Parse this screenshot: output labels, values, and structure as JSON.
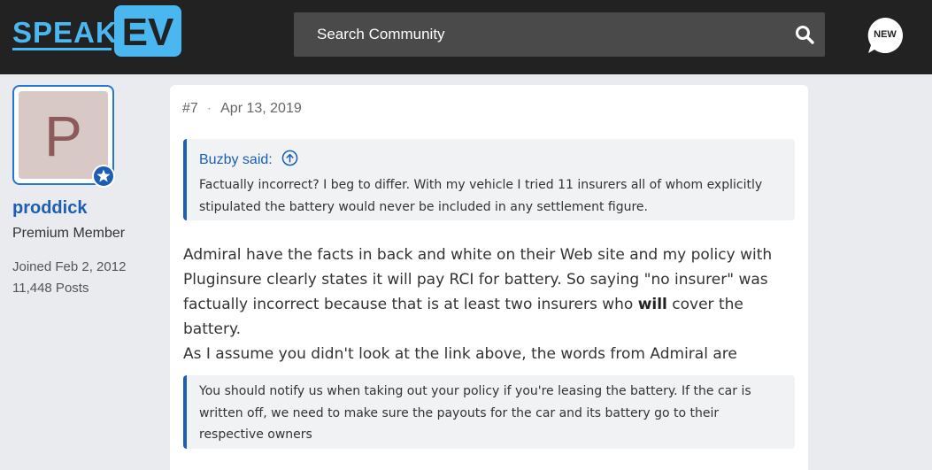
{
  "header": {
    "logo_text_speak": "SPEAK",
    "logo_text_ev": "EV",
    "search_placeholder": "Search Community",
    "new_badge": "NEW",
    "colors": {
      "background": "#222222",
      "accent": "#4ab7f0",
      "search_bg": "#4a4a4a"
    }
  },
  "user": {
    "avatar_letter": "P",
    "username": "proddick",
    "title": "Premium Member",
    "joined": "Joined Feb 2, 2012",
    "posts": "11,448 Posts"
  },
  "post": {
    "number": "#7",
    "separator": "·",
    "date": "Apr 13, 2019",
    "quote": {
      "author_line": "Buzby said:",
      "text": "Factually incorrect? I beg to differ. With my vehicle I tried 11 insurers all of whom explicitly stipulated the battery would never be included in any settlement figure."
    },
    "paragraph1_before": "Admiral have the facts in back and white on their Web site and my policy with Pluginsure clearly states it will pay RCI for battery. So saying \"no insurer\" was factually incorrect because that is at least two insurers who ",
    "paragraph1_bold": "will",
    "paragraph1_after": " cover the battery.",
    "paragraph2": "As I assume you didn't look at the link above, the words from Admiral are",
    "quote2_text": "You should notify us when taking out your policy if you're leasing the battery. If the car is written off, we need to make sure the payouts for the car and its battery go to their respective owners",
    "colors": {
      "link": "#1a5fb4",
      "quote_bg": "#f1f2f4"
    }
  }
}
